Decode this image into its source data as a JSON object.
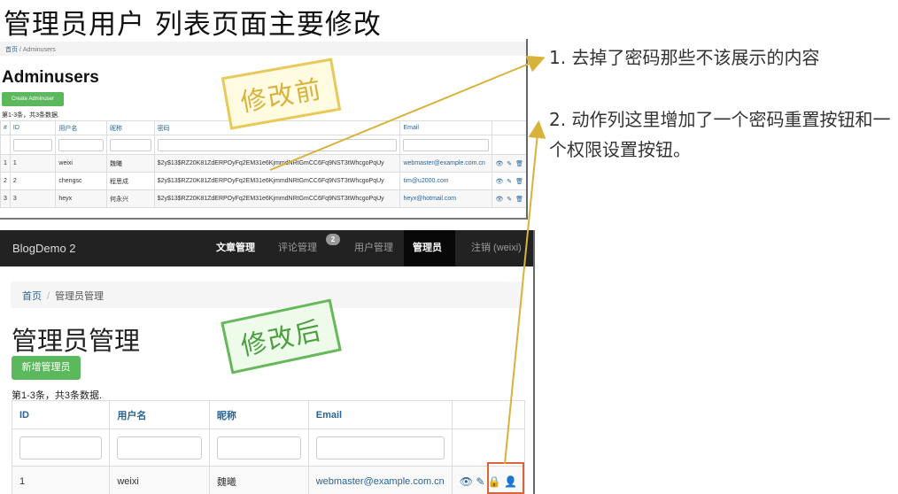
{
  "slide": {
    "title": "管理员用户 列表页面主要修改",
    "notes": [
      "1. 去掉了密码那些不该展示的内容",
      "2. 动作列这里增加了一个密码重置按钮和一个权限设置按钮。"
    ],
    "stamp_before": "修改前",
    "stamp_after": "修改后"
  },
  "before": {
    "breadcrumb": {
      "home": "首页",
      "current": "Adminusers"
    },
    "title": "Adminusers",
    "create_button": "Create Adminuser",
    "summary": "第1-3条，共3条数据.",
    "columns": [
      "#",
      "ID",
      "用户名",
      "昵称",
      "密码",
      "Email"
    ],
    "rows": [
      {
        "num": "1",
        "id": "1",
        "username": "weixi",
        "nickname": "魏曦",
        "password": "$2y$13$RZ20K81ZdERPOyFq2EM31e6KjmmdNRtGmCC6Fq9NST3tWhcgoPqUy",
        "email": "webmaster@example.com.cn"
      },
      {
        "num": "2",
        "id": "2",
        "username": "chengsc",
        "nickname": "程思成",
        "password": "$2y$13$RZ20K81ZdERPOyFq2EM31e6KjmmdNRtGmCC6Fq9NST3tWhcgoPqUy",
        "email": "tim@u2000.com"
      },
      {
        "num": "3",
        "id": "3",
        "username": "heyx",
        "nickname": "何永兴",
        "password": "$2y$13$RZ20K81ZdERPOyFq2EM31e6KjmmdNRtGmCC6Fq9NST3tWhcgoPqUy",
        "email": "heyx@hotmail.com"
      }
    ],
    "actions": "👁 ✎ 🗑"
  },
  "after": {
    "brand": "BlogDemo 2",
    "nav": [
      "文章管理",
      "评论管理",
      "用户管理",
      "管理员",
      "注销 (weixi)"
    ],
    "nav_badge": "2",
    "breadcrumb": {
      "home": "首页",
      "sep": "/",
      "current": "管理员管理"
    },
    "title": "管理员管理",
    "create_button": "新增管理员",
    "summary": "第1-3条，共3条数据.",
    "columns": [
      "ID",
      "用户名",
      "昵称",
      "Email"
    ],
    "rows": [
      {
        "id": "1",
        "username": "weixi",
        "nickname": "魏曦",
        "email": "webmaster@example.com.cn"
      }
    ],
    "actions": "👁 ✎ 🔒 👤"
  },
  "colors": {
    "accent": "#2a6496",
    "success": "#5cb85c",
    "navbar": "#222222",
    "arrow": "#d9b23c",
    "highlight": "#d9663a"
  }
}
